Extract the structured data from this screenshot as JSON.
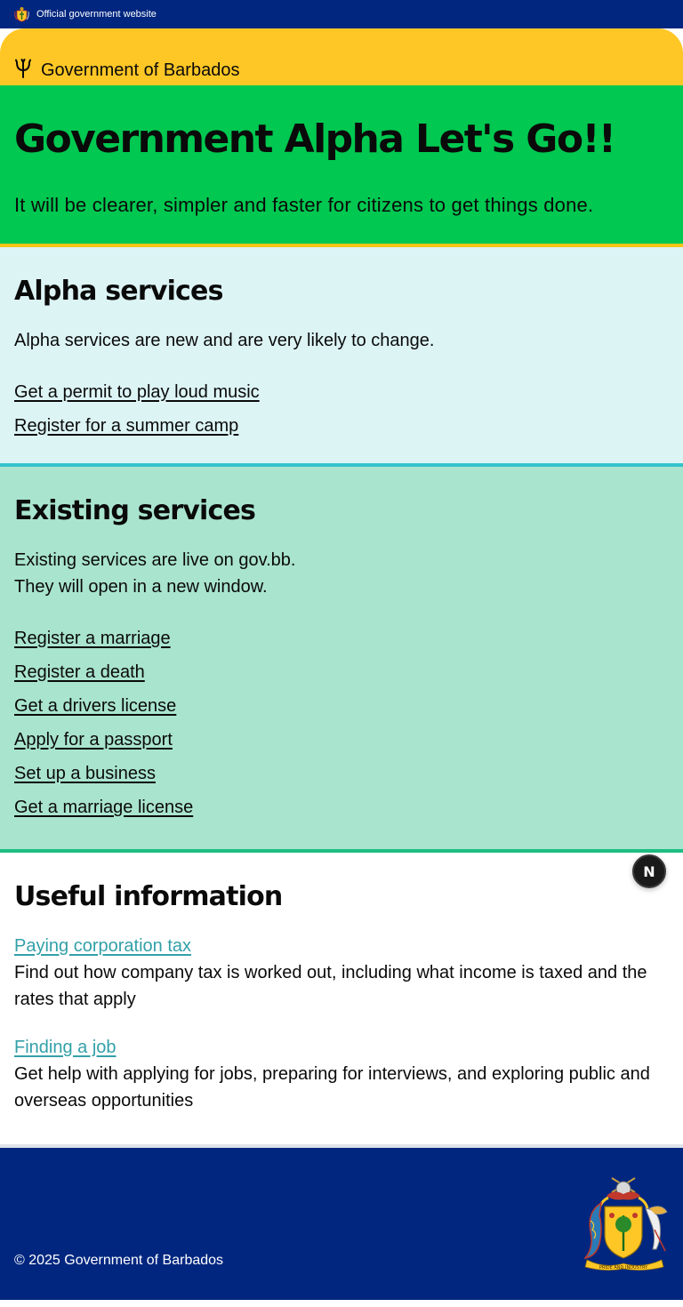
{
  "topbar": {
    "label": "Official government website",
    "icon": "coat-of-arms-icon"
  },
  "brand": {
    "icon": "trident-icon",
    "name": "Government of Barbados"
  },
  "hero": {
    "title": "Government Alpha Let's Go!!",
    "subtitle": "It will be clearer, simpler and faster for citizens to get things done."
  },
  "alpha": {
    "heading": "Alpha services",
    "intro": "Alpha services are new and are very likely to change.",
    "links": [
      "Get a permit to play loud music",
      "Register for a summer camp"
    ]
  },
  "existing": {
    "heading": "Existing services",
    "intro_line1": "Existing services are live on gov.bb.",
    "intro_line2": "They will open in a new window.",
    "links": [
      "Register a marriage",
      "Register a death",
      "Get a drivers license",
      "Apply for a passport",
      "Set up a business",
      "Get a marriage license"
    ]
  },
  "useful": {
    "heading": "Useful information",
    "items": [
      {
        "link": "Paying corporation tax",
        "description": "Find out how company tax is worked out, including what income is taxed and the rates that apply"
      },
      {
        "link": "Finding a job",
        "description": "Get help with applying for jobs, preparing for interviews, and exploring public and overseas opportunities"
      }
    ]
  },
  "dev_badge": {
    "letter": "N",
    "icon": "nextjs-icon"
  },
  "footer": {
    "copyright": "© 2025 Government of Barbados",
    "crest_icon": "coat-of-arms-icon",
    "motto": "PRIDE AND INDUSTRY"
  },
  "colors": {
    "navy": "#00267f",
    "gold": "#ffc726",
    "green": "#00c850",
    "alpha_bg": "#ddf4f5",
    "existing_bg": "#a9e4cf",
    "link_teal": "#33a0a8"
  }
}
